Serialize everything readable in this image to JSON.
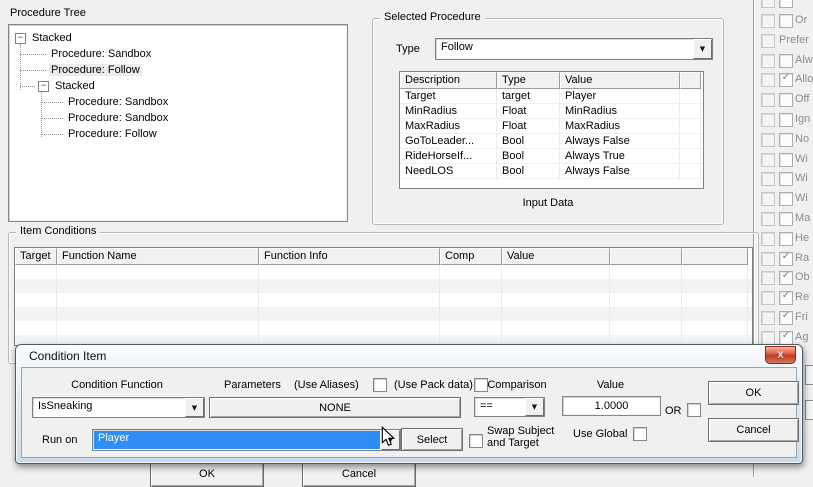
{
  "colors": {
    "selection_blue": "#2f8ef5",
    "close_button_red": "#c23a1e",
    "titlebar_tint": "#ccdbec"
  },
  "procedure_tree": {
    "label": "Procedure Tree",
    "items": [
      {
        "label": "Stacked",
        "depth": 0,
        "expand": true,
        "selected": false
      },
      {
        "label": "Procedure: Sandbox",
        "depth": 1,
        "expand": false,
        "selected": false
      },
      {
        "label": "Procedure: Follow",
        "depth": 1,
        "expand": false,
        "selected": true
      },
      {
        "label": "Stacked",
        "depth": 1,
        "expand": true,
        "selected": false
      },
      {
        "label": "Procedure: Sandbox",
        "depth": 2,
        "expand": false,
        "selected": false
      },
      {
        "label": "Procedure: Sandbox",
        "depth": 2,
        "expand": false,
        "selected": false
      },
      {
        "label": "Procedure: Follow",
        "depth": 2,
        "expand": false,
        "selected": false
      }
    ]
  },
  "selected_procedure": {
    "label": "Selected Procedure",
    "type_label": "Type",
    "type_value": "Follow",
    "table": {
      "headers": [
        "Description",
        "Type",
        "Value"
      ],
      "rows": [
        [
          "Target",
          "target",
          "Player"
        ],
        [
          "MinRadius",
          "Float",
          "MinRadius"
        ],
        [
          "MaxRadius",
          "Float",
          "MaxRadius"
        ],
        [
          "GoToLeader...",
          "Bool",
          "Always False"
        ],
        [
          "RideHorseIf...",
          "Bool",
          "Always True"
        ],
        [
          "NeedLOS",
          "Bool",
          "Always False"
        ]
      ]
    },
    "footer_label": "Input Data"
  },
  "flags_panel": {
    "rows": [
      {
        "label": "",
        "checked": false,
        "single": false
      },
      {
        "label": "Or",
        "checked": false,
        "single": false
      },
      {
        "label": "Prefer",
        "checked": false,
        "single": true
      },
      {
        "label": "Alw",
        "checked": false,
        "single": false
      },
      {
        "label": "Allo",
        "checked": true,
        "single": false
      },
      {
        "label": "Off",
        "checked": false,
        "single": false
      },
      {
        "label": "Ign",
        "checked": false,
        "single": false
      },
      {
        "label": "No",
        "checked": false,
        "single": false
      },
      {
        "label": "Wi",
        "checked": false,
        "single": false
      },
      {
        "label": "Wi",
        "checked": false,
        "single": false
      },
      {
        "label": "Wi",
        "checked": false,
        "single": false
      },
      {
        "label": "Ma",
        "checked": false,
        "single": false
      },
      {
        "label": "He",
        "checked": false,
        "single": false
      },
      {
        "label": "Ra",
        "checked": true,
        "single": false
      },
      {
        "label": "Ob",
        "checked": true,
        "single": false
      },
      {
        "label": "Re",
        "checked": true,
        "single": false
      },
      {
        "label": "Fri",
        "checked": true,
        "single": false
      },
      {
        "label": "Ag",
        "checked": true,
        "single": false
      }
    ]
  },
  "item_conditions": {
    "label": "Item Conditions",
    "headers": [
      "Target",
      "Function Name",
      "Function Info",
      "Comp",
      "Value",
      "",
      ""
    ]
  },
  "condition_item": {
    "title": "Condition Item",
    "condition_function_label": "Condition Function",
    "condition_function_value": "IsSneaking",
    "parameters_label": "Parameters",
    "use_aliases_label": "(Use Aliases)",
    "use_pack_label": "(Use Pack data)",
    "none_label": "NONE",
    "comparison_label": "Comparison",
    "comparison_value": "==",
    "value_label": "Value",
    "value_value": "1.0000",
    "or_label": "OR",
    "ok_label": "OK",
    "cancel_label": "Cancel",
    "run_on_label": "Run on",
    "run_on_value": "Player",
    "select_label": "Select",
    "swap_label_line1": "Swap Subject",
    "swap_label_line2": "and Target",
    "use_global_label": "Use Global",
    "close_label": "X"
  },
  "background_footer": {
    "ok_label": "OK",
    "cancel_label": "Cancel"
  }
}
